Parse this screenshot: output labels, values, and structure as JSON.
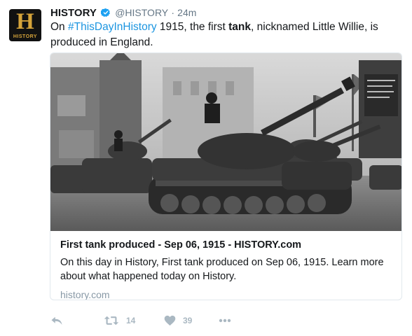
{
  "tweet": {
    "avatar": {
      "letter": "H",
      "label": "HISTORY"
    },
    "author_name": "HISTORY",
    "handle": "@HISTORY",
    "separator": "·",
    "time": "24m",
    "text": {
      "t1": "On ",
      "hashtag": "#ThisDayInHistory",
      "t2": " 1915, the first ",
      "bold": "tank",
      "t3": ", nicknamed Little Willie, is produced in England."
    }
  },
  "card": {
    "title": "First tank produced - Sep 06, 1915 - HISTORY.com",
    "description": "On this day in History, First tank produced on Sep 06, 1915. Learn more about what happened today on History.",
    "domain": "history.com"
  },
  "actions": {
    "retweet_count": "14",
    "like_count": "39"
  },
  "colors": {
    "link": "#1b95e0",
    "muted": "#657786",
    "icon": "#aab8c2",
    "brand_gold": "#d6a43a"
  },
  "icons": [
    "verified-icon",
    "reply-icon",
    "retweet-icon",
    "like-icon",
    "more-icon"
  ]
}
